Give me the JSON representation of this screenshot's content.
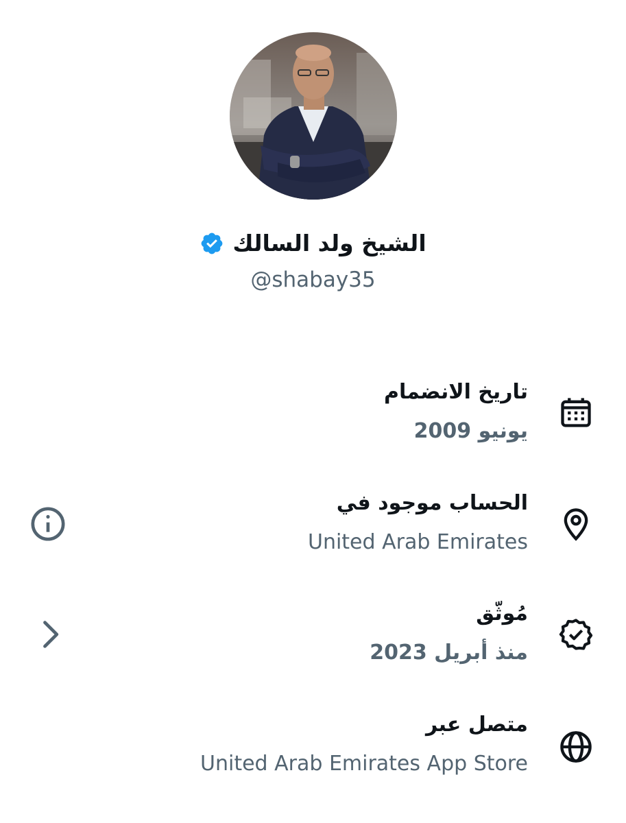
{
  "profile": {
    "display_name": "الشيخ ولد السالك",
    "handle": "@shabay35",
    "verified": true
  },
  "about": {
    "joined": {
      "title": "تاريخ الانضمام",
      "value": "يونيو 2009",
      "icon": "calendar-icon"
    },
    "location": {
      "title": "الحساب موجود في",
      "value": "United Arab Emirates",
      "icon": "location-pin-icon",
      "action_icon": "info-icon"
    },
    "verified": {
      "title": "مُوثّق",
      "value": "منذ أبريل 2023",
      "icon": "verified-badge-icon",
      "action_icon": "chevron-right-icon"
    },
    "connected_via": {
      "title": "متصل عبر",
      "value": "United Arab Emirates App Store",
      "icon": "globe-icon"
    }
  },
  "colors": {
    "text_primary": "#0f1419",
    "text_secondary": "#536471",
    "verified_blue": "#1d9bf0",
    "icon": "#0f1419"
  }
}
